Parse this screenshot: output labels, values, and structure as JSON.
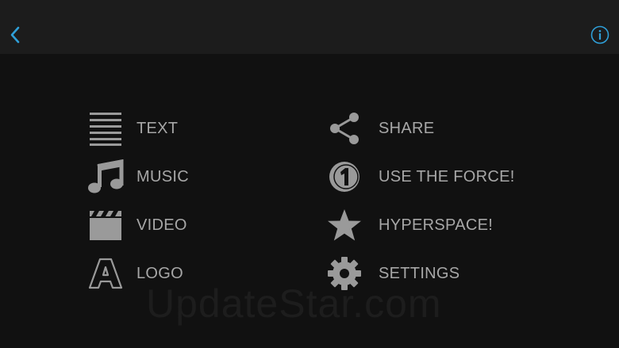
{
  "topbar": {
    "back_icon": "chevron-left-icon",
    "info_icon": "info-icon",
    "accent_color": "#2f9fd8"
  },
  "menu": {
    "left": [
      {
        "label": "TEXT",
        "icon": "text-lines-icon"
      },
      {
        "label": "MUSIC",
        "icon": "music-note-icon"
      },
      {
        "label": "VIDEO",
        "icon": "clapperboard-icon"
      },
      {
        "label": "LOGO",
        "icon": "logo-a-icon"
      }
    ],
    "right": [
      {
        "label": "SHARE",
        "icon": "share-icon"
      },
      {
        "label": "USE THE FORCE!",
        "icon": "coin-one-icon"
      },
      {
        "label": "HYPERSPACE!",
        "icon": "star-icon"
      },
      {
        "label": "SETTINGS",
        "icon": "gear-icon"
      }
    ],
    "text_color": "#a7a7a7",
    "icon_color": "#9a9a9a"
  },
  "watermark": {
    "text": "UpdateStar.com"
  }
}
